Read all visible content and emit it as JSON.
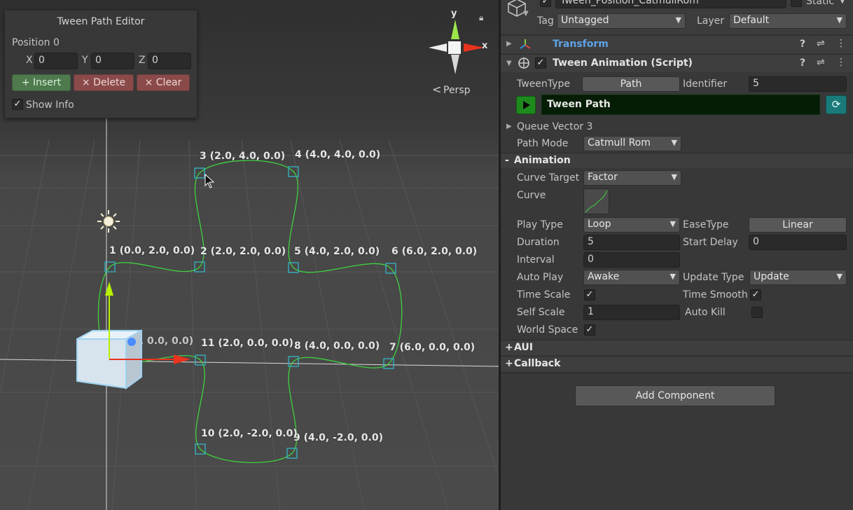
{
  "scene": {
    "persp_label": "Persp",
    "gizmo": {
      "y_label": "y",
      "x_label": "x"
    },
    "points": [
      {
        "label": "1 (0.0, 2.0, 0.0)"
      },
      {
        "label": "2 (2.0, 2.0, 0.0)"
      },
      {
        "label": "3 (2.0, 4.0, 0.0)"
      },
      {
        "label": "4 (4.0, 4.0, 0.0)"
      },
      {
        "label": "5 (4.0, 2.0, 0.0)"
      },
      {
        "label": "6 (6.0, 2.0, 0.0)"
      },
      {
        "label": "7 (6.0, 0.0, 0.0)"
      },
      {
        "label": "8 (4.0, 0.0, 0.0)"
      },
      {
        "label": "9 (4.0, -2.0, 0.0)"
      },
      {
        "label": "10 (2.0, -2.0, 0.0)"
      },
      {
        "label": "11 (2.0, 0.0, 0.0)"
      },
      {
        "label": "0 (0.0, 0.0, 0.0)"
      }
    ]
  },
  "tween_path_editor": {
    "title": "Tween Path Editor",
    "position_label": "Position 0",
    "x_label": "X",
    "x_value": "0",
    "y_label": "Y",
    "y_value": "0",
    "z_label": "Z",
    "z_value": "0",
    "insert_label": "+ Insert",
    "delete_label": "× Delete",
    "clear_label": "× Clear",
    "show_info_label": "Show Info",
    "show_info_check": "✓"
  },
  "inspector": {
    "object_name": "Tween_Position_CatmullRom",
    "static_label": "Static",
    "tag_label": "Tag",
    "tag_value": "Untagged",
    "layer_label": "Layer",
    "layer_value": "Default",
    "transform_label": "Transform",
    "script_label": "Tween Animation (Script)",
    "tween_type_label": "TweenType",
    "tween_type_value": "Path",
    "identifier_label": "Identifier",
    "identifier_value": "5",
    "tween_path_name": "Tween Path",
    "queue_label": "Queue Vector 3",
    "path_mode_label": "Path Mode",
    "path_mode_value": "Catmull Rom",
    "animation_section": "Animation",
    "curve_target_label": "Curve Target",
    "curve_target_value": "Factor",
    "curve_label": "Curve",
    "play_type_label": "Play Type",
    "play_type_value": "Loop",
    "ease_type_label": "EaseType",
    "ease_type_value": "Linear",
    "duration_label": "Duration",
    "duration_value": "5",
    "start_delay_label": "Start Delay",
    "start_delay_value": "0",
    "interval_label": "Interval",
    "interval_value": "0",
    "auto_play_label": "Auto Play",
    "auto_play_value": "Awake",
    "update_type_label": "Update Type",
    "update_type_value": "Update",
    "time_scale_label": "Time Scale",
    "time_smooth_label": "Time Smooth",
    "self_scale_label": "Self Scale",
    "self_scale_value": "1",
    "auto_kill_label": "Auto Kill",
    "world_space_label": "World Space",
    "aui_section": "AUI",
    "callback_section": "Callback",
    "add_component_label": "Add Component",
    "check_mark": "✓",
    "minus": "-",
    "plus": "+"
  },
  "colors": {
    "path": "#3fd13f",
    "handle": "#35b4c8",
    "insert_bg": "#4e7a4e",
    "delete_bg": "#8a4a4a",
    "play_green": "#1e8a1e",
    "path_bar": "#041d04",
    "link_blue": "#5ea3e8"
  }
}
